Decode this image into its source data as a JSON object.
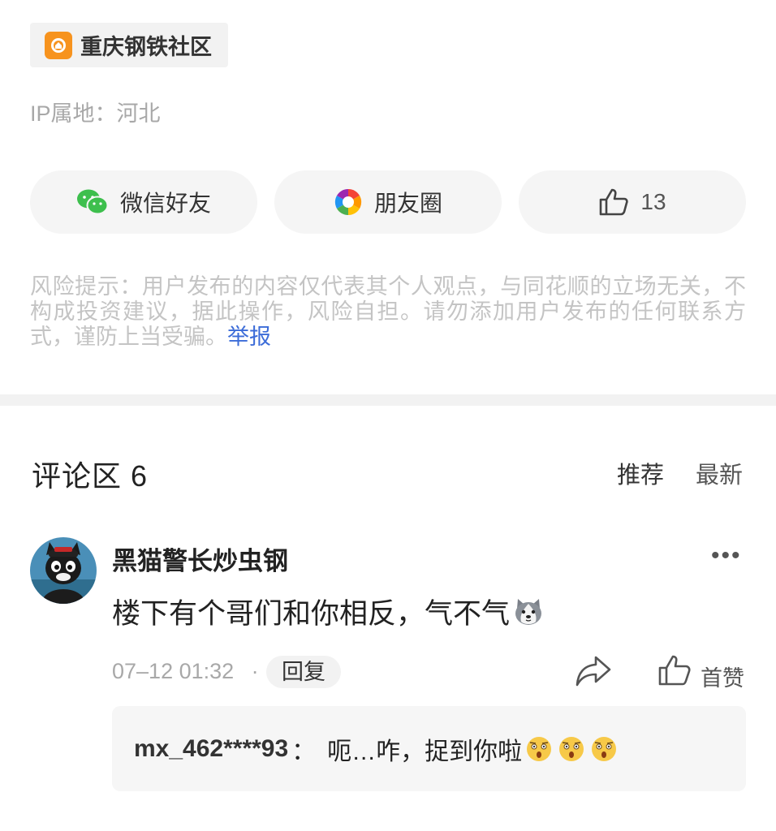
{
  "community": {
    "name": "重庆钢铁社区",
    "icon": "community-icon",
    "icon_color": "#f7931e"
  },
  "ip_location": "IP属地：河北",
  "share": {
    "wechat_friends": "微信好友",
    "moments": "朋友圈",
    "like_count": "13"
  },
  "risk_notice": {
    "text": "风险提示：用户发布的内容仅代表其个人观点，与同花顺的立场无关，不构成投资建议，据此操作，风险自担。请勿添加用户发布的任何联系方式，谨防上当受骗。",
    "report_link": "举报",
    "link_color": "#3c6cd8"
  },
  "comments": {
    "title": "评论区 6",
    "sort_recommend": "推荐",
    "sort_latest": "最新",
    "items": [
      {
        "username": "黑猫警长炒虫钢",
        "text": "楼下有个哥们和你相反，气不气",
        "emoji": "husky-emoji",
        "time": "07–12 01:32",
        "separator": "·",
        "reply_label": "回复",
        "like_label": "首赞",
        "replies": [
          {
            "user": "mx_462****93",
            "separator": "：",
            "text": "呃…咋，捉到你啦",
            "emoji": "surprised-face-emoji"
          }
        ]
      }
    ]
  }
}
